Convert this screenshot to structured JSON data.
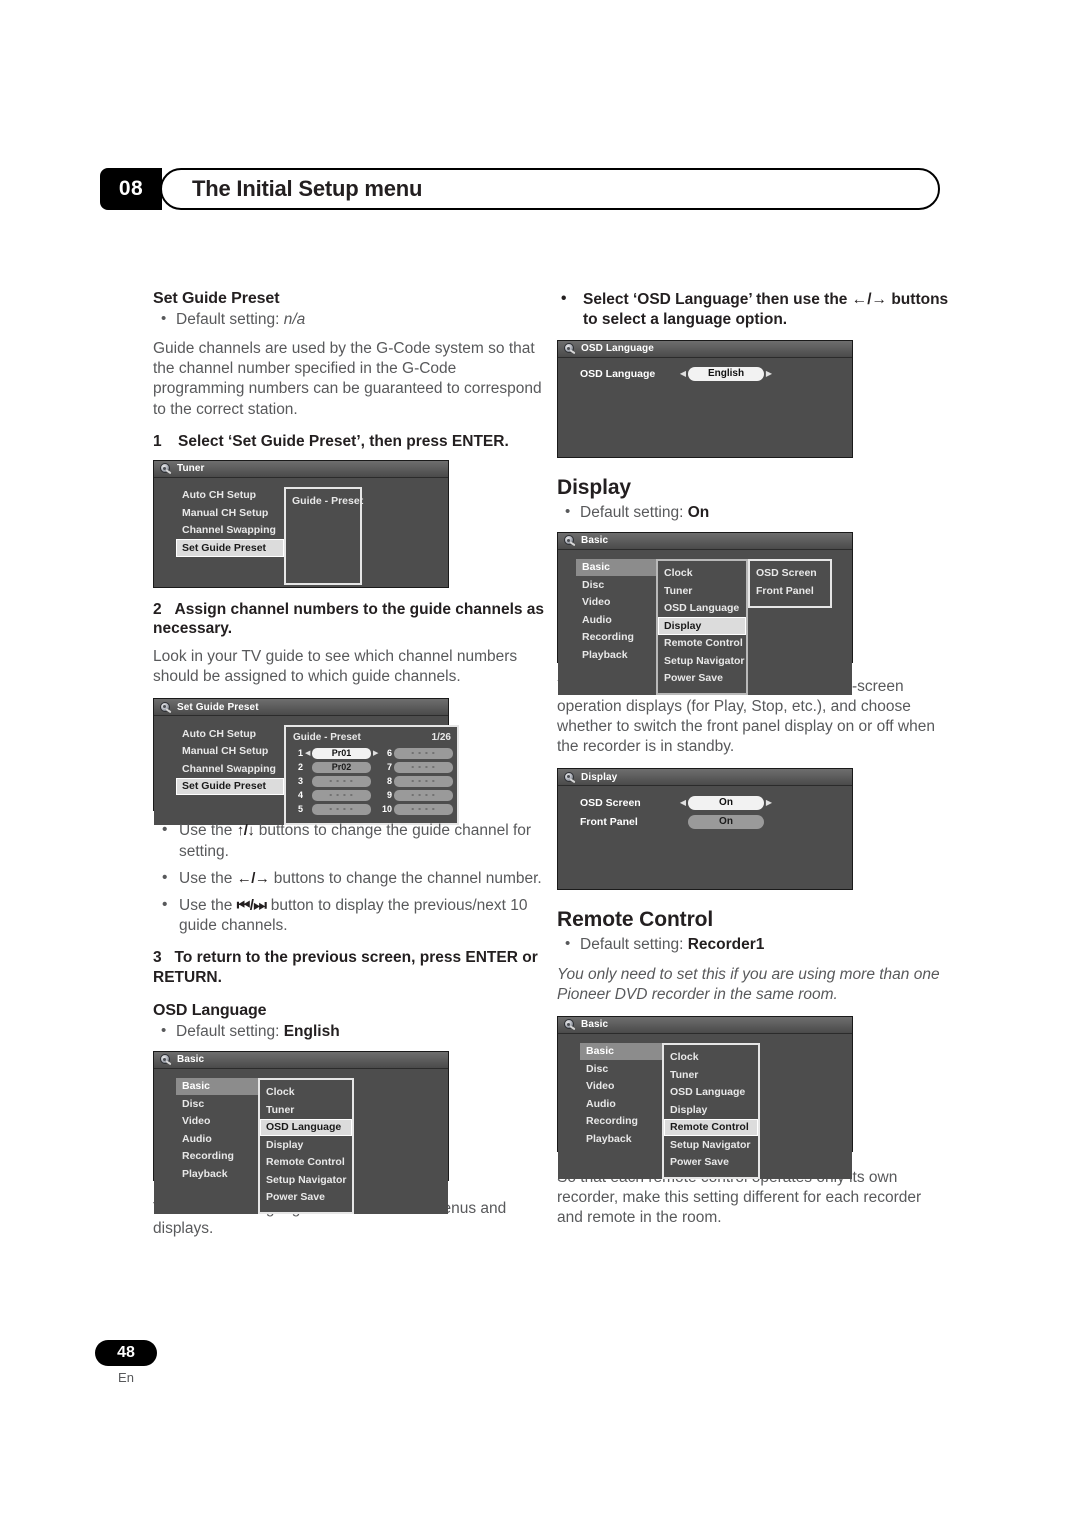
{
  "header": {
    "chapter_number": "08",
    "chapter_title": "The Initial Setup menu",
    "disc_icon": "disc-icon"
  },
  "footer": {
    "page_number": "48",
    "language_code": "En"
  },
  "left_column": {
    "set_guide_preset": {
      "heading": "Set Guide Preset",
      "default_label": "Default setting:",
      "default_value": "n/a",
      "intro": "Guide channels are used by the G-Code system so that the channel number specified in the G-Code programming numbers can be guaranteed to correspond to the correct station.",
      "step1_num": "1",
      "step1_text": "Select ‘Set Guide Preset’, then press ENTER.",
      "step2_num": "2",
      "step2_text": "Assign channel numbers to the guide channels as necessary.",
      "step2_body": "Look in your TV guide to see which channel numbers should be assigned to which guide channels.",
      "bullets": [
        {
          "pre": "Use the ",
          "keys": "↑/↓",
          "post": " buttons to change the guide channel for setting."
        },
        {
          "pre": "Use the ",
          "keys": "←/→",
          "post": " buttons to change the channel number."
        },
        {
          "pre": "Use the ",
          "keys": "⏮/⏭",
          "post": " button to display the previous/next 10 guide channels."
        }
      ],
      "step3_num": "3",
      "step3_text": "To return to the previous screen, press ENTER or RETURN."
    },
    "tuner_screen": {
      "title": "Tuner",
      "menu": [
        "Auto CH Setup",
        "Manual CH Setup",
        "Channel Swapping",
        "Set Guide Preset"
      ],
      "selected": "Set Guide Preset",
      "panel_title": "Guide - Preset"
    },
    "guide_preset_screen": {
      "title": "Set Guide Preset",
      "menu": [
        "Auto CH Setup",
        "Manual CH Setup",
        "Channel Swapping",
        "Set Guide Preset"
      ],
      "selected": "Set Guide Preset",
      "panel_title": "Guide - Preset",
      "page_counter": "1/26",
      "left_rows": [
        {
          "num": "1",
          "value": "Pr01",
          "active": true
        },
        {
          "num": "2",
          "value": "Pr02",
          "active": false
        },
        {
          "num": "3",
          "value": "- - - -",
          "active": false
        },
        {
          "num": "4",
          "value": "- - - -",
          "active": false
        },
        {
          "num": "5",
          "value": "- - - -",
          "active": false
        }
      ],
      "right_rows": [
        {
          "num": "6",
          "value": "- - - -",
          "active": false
        },
        {
          "num": "7",
          "value": "- - - -",
          "active": false
        },
        {
          "num": "8",
          "value": "- - - -",
          "active": false
        },
        {
          "num": "9",
          "value": "- - - -",
          "active": false
        },
        {
          "num": "10",
          "value": "- - - -",
          "active": false
        }
      ]
    },
    "osd_language": {
      "heading": "OSD Language",
      "default_label": "Default setting:",
      "default_value": "English",
      "body": "This sets the language of the on-screen menus and displays."
    },
    "basic_osdlang_screen": {
      "title": "Basic",
      "col1": [
        "Basic",
        "Disc",
        "Video",
        "Audio",
        "Recording",
        "Playback"
      ],
      "col1_selected": "Basic",
      "col2": [
        "Clock",
        "Tuner",
        "OSD Language",
        "Display",
        "Remote Control",
        "Setup Navigator",
        "Power Save"
      ],
      "col2_selected": "OSD Language"
    }
  },
  "right_column": {
    "osd_language_bullet": "Select ‘OSD Language’ then use the ←/→ buttons to select a language option.",
    "osd_language_screen": {
      "title": "OSD Language",
      "rows": [
        {
          "label": "OSD Language",
          "value": "English",
          "arrows": true,
          "grey": false
        }
      ]
    },
    "display": {
      "heading": "Display",
      "default_label": "Default setting:",
      "default_value": "On",
      "body": "You can have the recorder show or hide on-screen operation displays (for Play, Stop, etc.), and choose whether to switch the front panel display on or off when the recorder is in standby."
    },
    "basic_display_screen": {
      "title": "Basic",
      "col1": [
        "Basic",
        "Disc",
        "Video",
        "Audio",
        "Recording",
        "Playback"
      ],
      "col1_selected": "Basic",
      "col2": [
        "Clock",
        "Tuner",
        "OSD Language",
        "Display",
        "Remote Control",
        "Setup Navigator",
        "Power Save"
      ],
      "col2_selected": "Display",
      "col3": [
        "OSD Screen",
        "Front Panel"
      ]
    },
    "display_screen": {
      "title": "Display",
      "rows": [
        {
          "label": "OSD Screen",
          "value": "On",
          "arrows": true,
          "grey": false
        },
        {
          "label": "Front Panel",
          "value": "On",
          "arrows": false,
          "grey": true
        }
      ]
    },
    "remote_control": {
      "heading": "Remote Control",
      "default_label": "Default setting:",
      "default_value": "Recorder1",
      "note": "You only need to set this if you are using more than one Pioneer DVD recorder in the same room.",
      "body": "So that each remote control operates only its own recorder, make this setting different for each recorder and remote in the room."
    },
    "basic_remote_screen": {
      "title": "Basic",
      "col1": [
        "Basic",
        "Disc",
        "Video",
        "Audio",
        "Recording",
        "Playback"
      ],
      "col1_selected": "Basic",
      "col2": [
        "Clock",
        "Tuner",
        "OSD Language",
        "Display",
        "Remote Control",
        "Setup Navigator",
        "Power Save"
      ],
      "col2_selected": "Remote Control"
    }
  }
}
